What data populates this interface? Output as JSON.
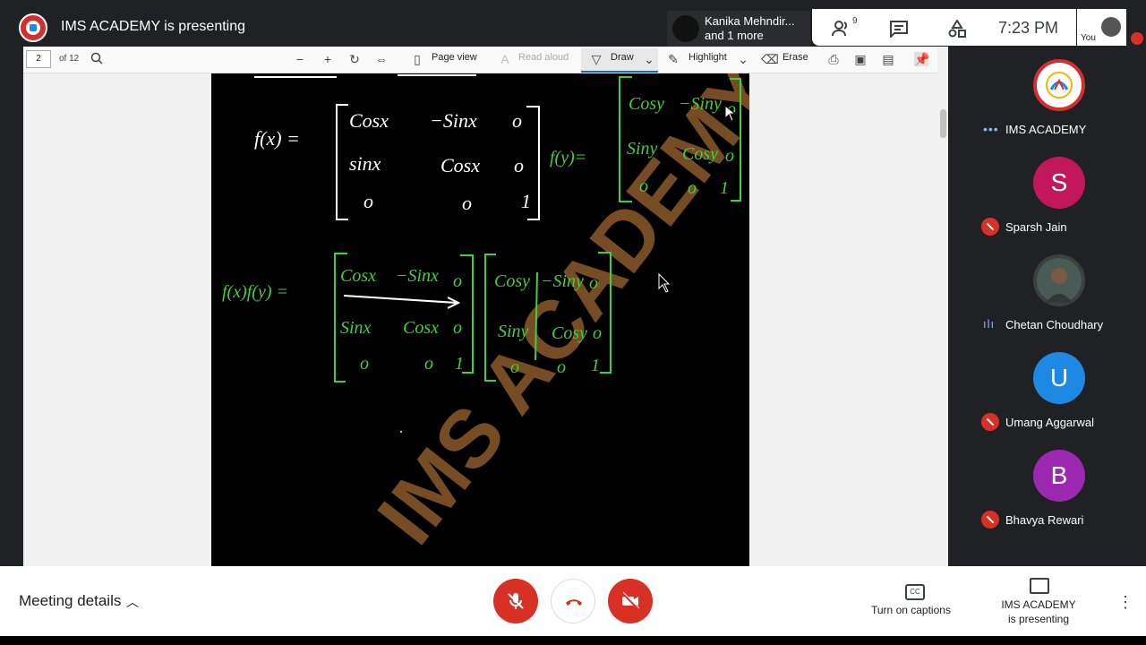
{
  "top": {
    "presenting_title": "IMS ACADEMY is presenting",
    "speaker_line1": "Kanika Mehndir...",
    "speaker_line2": "and 1 more",
    "people_count": "9",
    "time": "7:23 PM",
    "you_label": "You"
  },
  "pdf_toolbar": {
    "page_value": "2",
    "page_total": "of 12",
    "page_view": "Page view",
    "read_aloud": "Read aloud",
    "draw": "Draw",
    "highlight": "Highlight",
    "erase": "Erase"
  },
  "whiteboard": {
    "watermark": "IMS ACADEMY"
  },
  "participants": [
    {
      "name": "IMS ACADEMY",
      "type": "logo"
    },
    {
      "name": "Sparsh Jain",
      "initial": "S",
      "color": "#c2185b",
      "muted": true
    },
    {
      "name": "Chetan Choudhary",
      "type": "photo",
      "muted": false
    },
    {
      "name": "Umang Aggarwal",
      "initial": "U",
      "color": "#1e88e5",
      "muted": true
    },
    {
      "name": "Bhavya Rewari",
      "initial": "B",
      "color": "#9c27b0",
      "muted": true
    }
  ],
  "bottom": {
    "meeting_details": "Meeting details",
    "captions": "Turn on captions",
    "presenting_line1": "IMS ACADEMY",
    "presenting_line2": "is presenting"
  },
  "colors": {
    "bar_bg": "#202124",
    "danger": "#d93025",
    "ink_green": "#3fd13a",
    "watermark": "#8a5a2b"
  }
}
